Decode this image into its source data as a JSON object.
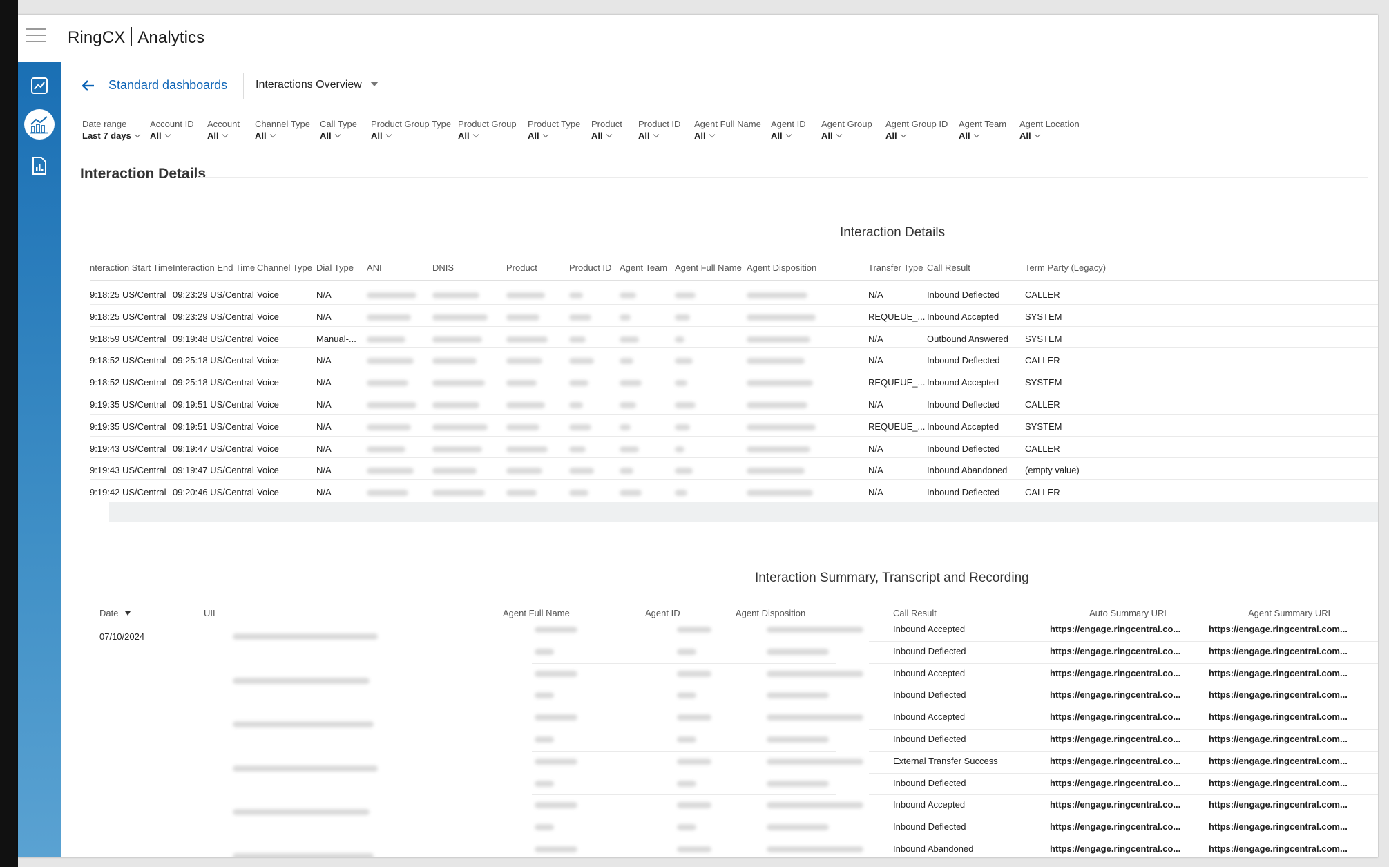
{
  "app": {
    "title_left": "RingCX",
    "title_right": "Analytics"
  },
  "breadcrumb": {
    "link": "Standard dashboards",
    "dashboard": "Interactions Overview"
  },
  "filters": [
    {
      "label": "Date range",
      "value": "Last 7 days"
    },
    {
      "label": "Account ID",
      "value": "All"
    },
    {
      "label": "Account",
      "value": "All"
    },
    {
      "label": "Channel Type",
      "value": "All"
    },
    {
      "label": "Call Type",
      "value": "All"
    },
    {
      "label": "Product Group Type",
      "value": "All"
    },
    {
      "label": "Product Group",
      "value": "All"
    },
    {
      "label": "Product Type",
      "value": "All"
    },
    {
      "label": "Product",
      "value": "All"
    },
    {
      "label": "Product ID",
      "value": "All"
    },
    {
      "label": "Agent Full Name",
      "value": "All"
    },
    {
      "label": "Agent ID",
      "value": "All"
    },
    {
      "label": "Agent Group",
      "value": "All"
    },
    {
      "label": "Agent Group ID",
      "value": "All"
    },
    {
      "label": "Agent Team",
      "value": "All"
    },
    {
      "label": "Agent Location",
      "value": "All"
    }
  ],
  "section_title": "Interaction Details",
  "table1": {
    "title": "Interaction Details",
    "headers": [
      "nteraction Start Time",
      "Interaction End Time",
      "Channel Type",
      "Dial Type",
      "ANI",
      "DNIS",
      "Product",
      "Product ID",
      "Agent Team",
      "Agent Full Name",
      "Agent Disposition",
      "Transfer Type",
      "Call Result",
      "Term Party (Legacy)"
    ],
    "rows": [
      {
        "start": "9:18:25 US/Central",
        "end": "09:23:29 US/Central",
        "channel": "Voice",
        "dial": "N/A",
        "transfer": "N/A",
        "result": "Inbound Deflected",
        "term": "CALLER"
      },
      {
        "start": "9:18:25 US/Central",
        "end": "09:23:29 US/Central",
        "channel": "Voice",
        "dial": "N/A",
        "transfer": "REQUEUE_...",
        "result": "Inbound Accepted",
        "term": "SYSTEM"
      },
      {
        "start": "9:18:59 US/Central",
        "end": "09:19:48 US/Central",
        "channel": "Voice",
        "dial": "Manual-...",
        "transfer": "N/A",
        "result": "Outbound Answered",
        "term": "SYSTEM"
      },
      {
        "start": "9:18:52 US/Central",
        "end": "09:25:18 US/Central",
        "channel": "Voice",
        "dial": "N/A",
        "transfer": "N/A",
        "result": "Inbound Deflected",
        "term": "CALLER"
      },
      {
        "start": "9:18:52 US/Central",
        "end": "09:25:18 US/Central",
        "channel": "Voice",
        "dial": "N/A",
        "transfer": "REQUEUE_...",
        "result": "Inbound Accepted",
        "term": "SYSTEM"
      },
      {
        "start": "9:19:35 US/Central",
        "end": "09:19:51 US/Central",
        "channel": "Voice",
        "dial": "N/A",
        "transfer": "N/A",
        "result": "Inbound Deflected",
        "term": "CALLER"
      },
      {
        "start": "9:19:35 US/Central",
        "end": "09:19:51 US/Central",
        "channel": "Voice",
        "dial": "N/A",
        "transfer": "REQUEUE_...",
        "result": "Inbound Accepted",
        "term": "SYSTEM"
      },
      {
        "start": "9:19:43 US/Central",
        "end": "09:19:47 US/Central",
        "channel": "Voice",
        "dial": "N/A",
        "transfer": "N/A",
        "result": "Inbound Deflected",
        "term": "CALLER"
      },
      {
        "start": "9:19:43 US/Central",
        "end": "09:19:47 US/Central",
        "channel": "Voice",
        "dial": "N/A",
        "transfer": "N/A",
        "result": "Inbound Abandoned",
        "term": "(empty value)"
      },
      {
        "start": "9:19:42 US/Central",
        "end": "09:20:46 US/Central",
        "channel": "Voice",
        "dial": "N/A",
        "transfer": "N/A",
        "result": "Inbound Deflected",
        "term": "CALLER"
      }
    ]
  },
  "table2": {
    "title": "Interaction Summary, Transcript and Recording",
    "headers": [
      "Date",
      "UII",
      "Agent Full Name",
      "Agent ID",
      "Agent Disposition",
      "Call Result",
      "Auto Summary URL",
      "Agent Summary URL"
    ],
    "date_value": "07/10/2024",
    "rows": [
      {
        "result": "Inbound Accepted",
        "auto": "https://engage.ringcentral.co...",
        "agent": "https://engage.ringcentral.com..."
      },
      {
        "result": "Inbound Deflected",
        "auto": "https://engage.ringcentral.co...",
        "agent": "https://engage.ringcentral.com..."
      },
      {
        "result": "Inbound Accepted",
        "auto": "https://engage.ringcentral.co...",
        "agent": "https://engage.ringcentral.com..."
      },
      {
        "result": "Inbound Deflected",
        "auto": "https://engage.ringcentral.co...",
        "agent": "https://engage.ringcentral.com..."
      },
      {
        "result": "Inbound Accepted",
        "auto": "https://engage.ringcentral.co...",
        "agent": "https://engage.ringcentral.com..."
      },
      {
        "result": "Inbound Deflected",
        "auto": "https://engage.ringcentral.co...",
        "agent": "https://engage.ringcentral.com..."
      },
      {
        "result": "External Transfer Success",
        "auto": "https://engage.ringcentral.co...",
        "agent": "https://engage.ringcentral.com..."
      },
      {
        "result": "Inbound Deflected",
        "auto": "https://engage.ringcentral.co...",
        "agent": "https://engage.ringcentral.com..."
      },
      {
        "result": "Inbound Accepted",
        "auto": "https://engage.ringcentral.co...",
        "agent": "https://engage.ringcentral.com..."
      },
      {
        "result": "Inbound Deflected",
        "auto": "https://engage.ringcentral.co...",
        "agent": "https://engage.ringcentral.com..."
      },
      {
        "result": "Inbound Abandoned",
        "auto": "https://engage.ringcentral.co...",
        "agent": "https://engage.ringcentral.com..."
      }
    ]
  },
  "icons": {
    "menu": "hamburger-icon",
    "back": "arrow-left-icon",
    "rail": [
      "trend-chart-icon",
      "dashboard-chart-icon",
      "report-document-icon"
    ]
  },
  "colors": {
    "brand_blue": "#0b63b6",
    "rail_top": "#1a6fb4",
    "rail_bottom": "#5aa2d2"
  }
}
